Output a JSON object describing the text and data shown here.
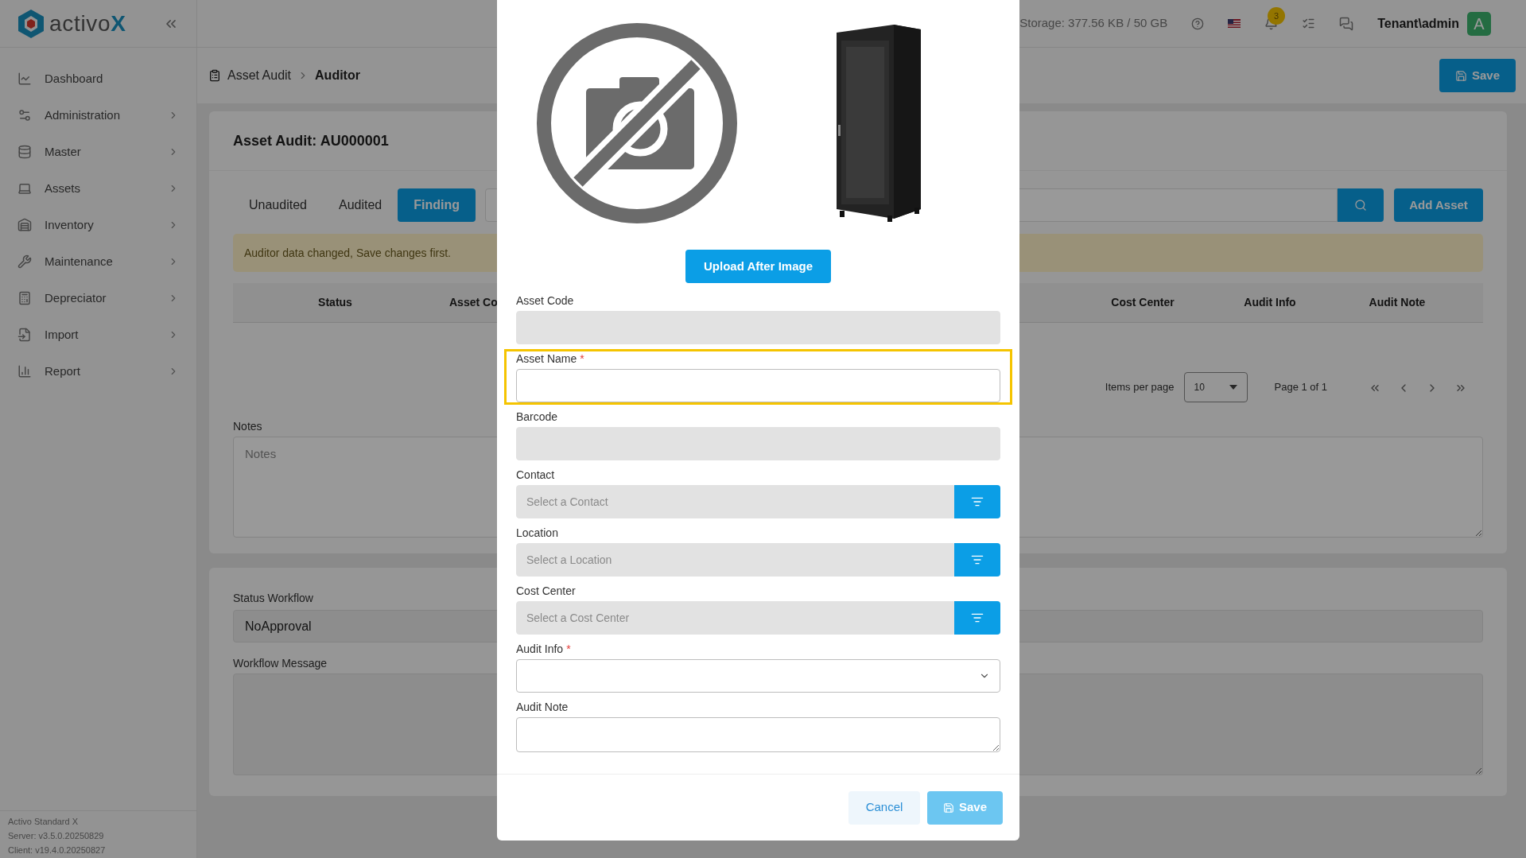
{
  "logo": {
    "text": "activo",
    "accent": "X"
  },
  "sidebar": {
    "items": [
      {
        "label": "Dashboard",
        "expandable": false
      },
      {
        "label": "Administration",
        "expandable": true
      },
      {
        "label": "Master",
        "expandable": true
      },
      {
        "label": "Assets",
        "expandable": true
      },
      {
        "label": "Inventory",
        "expandable": true
      },
      {
        "label": "Maintenance",
        "expandable": true
      },
      {
        "label": "Depreciator",
        "expandable": true
      },
      {
        "label": "Import",
        "expandable": true
      },
      {
        "label": "Report",
        "expandable": true
      }
    ],
    "footer": [
      "Activo Standard X",
      "Server: v3.5.0.20250829",
      "Client: v19.4.0.20250827"
    ]
  },
  "header": {
    "storage": "Storage: 377.56 KB / 50 GB",
    "notifications": "3",
    "user": "Tenant\\admin",
    "avatar": "A"
  },
  "breadcrumb": [
    "Asset Audit",
    "Auditor"
  ],
  "save_button": "Save",
  "page_title": "Asset Audit: AU000001",
  "tabs": [
    {
      "label": "Unaudited",
      "selected": false
    },
    {
      "label": "Audited",
      "selected": false
    },
    {
      "label": "Finding",
      "selected": true
    }
  ],
  "add_asset_button": "Add Asset",
  "alert": "Auditor data changed, Save changes first.",
  "table": {
    "columns_left": [
      "Status",
      "Asset Co"
    ],
    "columns_right": [
      "Cost Center",
      "Audit Info",
      "Audit Note"
    ]
  },
  "pagination": {
    "items_per_page_label": "Items per page",
    "page_size": "10",
    "page_info": "Page 1 of 1"
  },
  "notes": {
    "label": "Notes",
    "placeholder": "Notes"
  },
  "workflow": {
    "status_label": "Status Workflow",
    "status_value": "NoApproval",
    "message_label": "Workflow Message"
  },
  "modal": {
    "upload_button": "Upload After Image",
    "fields": [
      {
        "label": "Asset Code",
        "kind": "text",
        "required": false,
        "disabled": true,
        "highlighted": false
      },
      {
        "label": "Asset Name",
        "kind": "text",
        "required": true,
        "disabled": false,
        "highlighted": true
      },
      {
        "label": "Barcode",
        "kind": "text",
        "required": false,
        "disabled": true,
        "highlighted": false
      },
      {
        "label": "Contact",
        "kind": "lookup",
        "placeholder": "Select a Contact",
        "required": false,
        "disabled": true,
        "highlighted": false
      },
      {
        "label": "Location",
        "kind": "lookup",
        "placeholder": "Select a Location",
        "required": false,
        "disabled": true,
        "highlighted": false
      },
      {
        "label": "Cost Center",
        "kind": "lookup",
        "placeholder": "Select a Cost Center",
        "required": false,
        "disabled": true,
        "highlighted": false
      },
      {
        "label": "Audit Info",
        "kind": "select",
        "required": true,
        "disabled": false,
        "highlighted": false
      },
      {
        "label": "Audit Note",
        "kind": "textarea",
        "required": false,
        "disabled": false,
        "highlighted": false
      }
    ],
    "required_mark": "*",
    "cancel_button": "Cancel",
    "save_button": "Save",
    "save_disabled": true
  }
}
